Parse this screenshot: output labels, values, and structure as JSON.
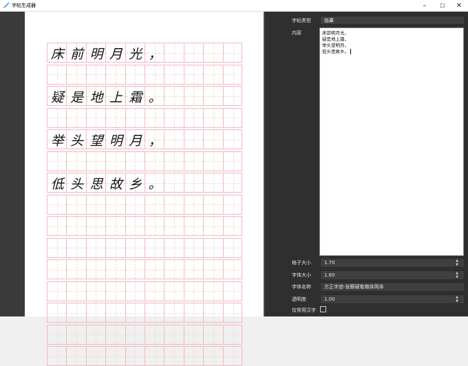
{
  "window": {
    "title": "字帖生成器",
    "minimize": "–",
    "maximize": "☐",
    "close": "✕"
  },
  "preview": {
    "rows": [
      [
        "床",
        "前",
        "明",
        "月",
        "光",
        "，"
      ],
      [],
      [
        "疑",
        "是",
        "地",
        "上",
        "霜",
        "。"
      ],
      [],
      [
        "举",
        "头",
        "望",
        "明",
        "月",
        "，"
      ],
      [],
      [
        "低",
        "头",
        "思",
        "故",
        "乡",
        "。"
      ],
      [],
      [],
      [],
      [],
      [],
      [],
      [],
      []
    ]
  },
  "panel": {
    "type_label": "字帖类型",
    "type_value": "临摹",
    "content_label": "内容",
    "content_lines": [
      "床前明月光，",
      "疑是地上霜，",
      "举头望明月，",
      "低头思故乡。"
    ],
    "grid_size_label": "格子大小",
    "grid_size_value": "1.70",
    "font_size_label": "字体大小",
    "font_size_value": "1.60",
    "font_name_label": "字体名称",
    "font_name_value": "方正字迹-张颢硬笔楷体简体",
    "opacity_label": "透明度",
    "opacity_value": "1.00",
    "common_only_label": "仅常用汉字",
    "common_only_checked": false
  },
  "colors": {
    "grid_line": "#f3b8bd",
    "panel_bg": "#2f2f2f",
    "accent": "#1e88e5"
  }
}
